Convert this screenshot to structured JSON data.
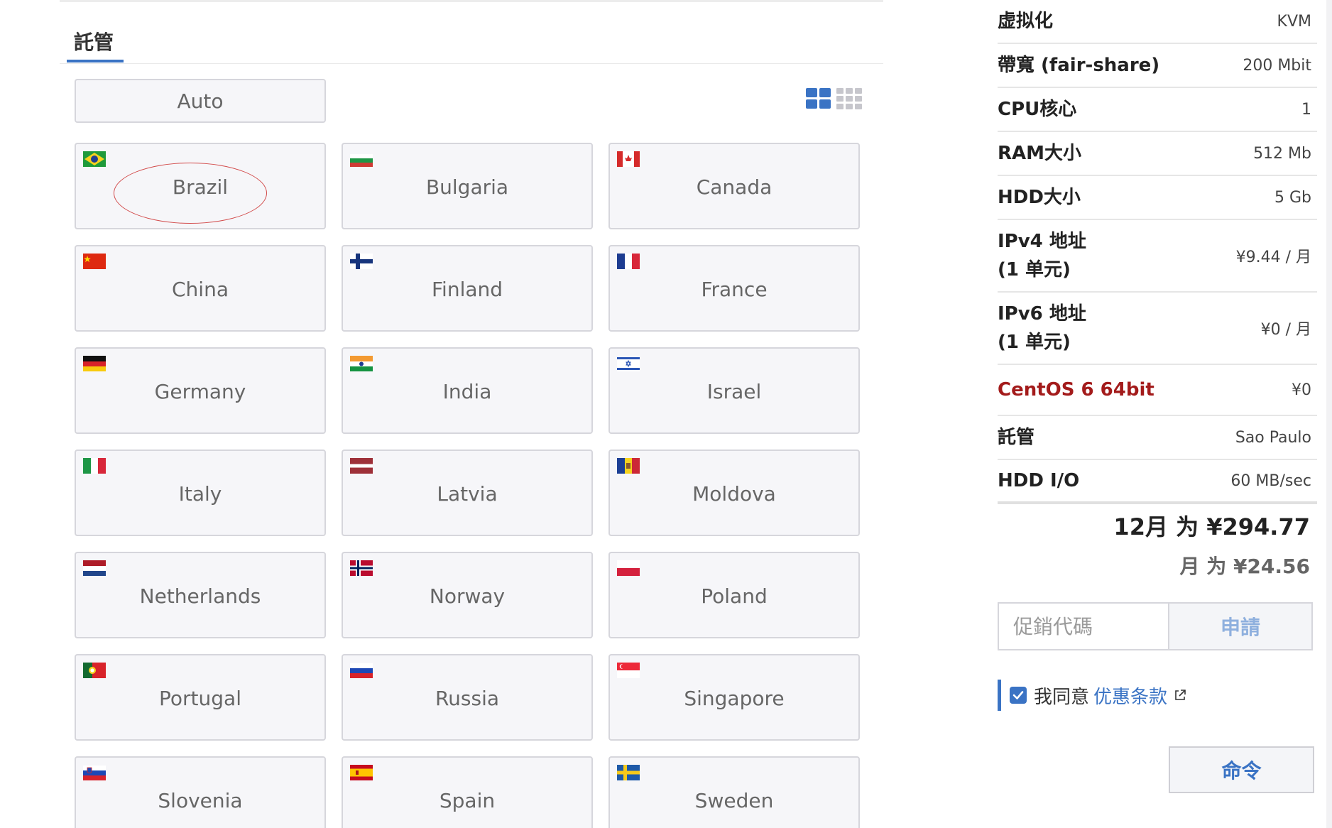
{
  "tabs": {
    "hosting_label": "託管"
  },
  "location_selector": {
    "auto_label": "Auto",
    "view_toggle": {
      "active": "large-grid-icon",
      "inactive": "small-grid-icon"
    },
    "countries": [
      {
        "name": "Brazil",
        "flag": "flag-brazil-icon",
        "highlighted": true
      },
      {
        "name": "Bulgaria",
        "flag": "flag-bulgaria-icon"
      },
      {
        "name": "Canada",
        "flag": "flag-canada-icon"
      },
      {
        "name": "China",
        "flag": "flag-china-icon"
      },
      {
        "name": "Finland",
        "flag": "flag-finland-icon"
      },
      {
        "name": "France",
        "flag": "flag-france-icon"
      },
      {
        "name": "Germany",
        "flag": "flag-germany-icon"
      },
      {
        "name": "India",
        "flag": "flag-india-icon"
      },
      {
        "name": "Israel",
        "flag": "flag-israel-icon"
      },
      {
        "name": "Italy",
        "flag": "flag-italy-icon"
      },
      {
        "name": "Latvia",
        "flag": "flag-latvia-icon"
      },
      {
        "name": "Moldova",
        "flag": "flag-moldova-icon"
      },
      {
        "name": "Netherlands",
        "flag": "flag-netherlands-icon"
      },
      {
        "name": "Norway",
        "flag": "flag-norway-icon"
      },
      {
        "name": "Poland",
        "flag": "flag-poland-icon"
      },
      {
        "name": "Portugal",
        "flag": "flag-portugal-icon"
      },
      {
        "name": "Russia",
        "flag": "flag-russia-icon"
      },
      {
        "name": "Singapore",
        "flag": "flag-singapore-icon"
      },
      {
        "name": "Slovenia",
        "flag": "flag-slovenia-icon"
      },
      {
        "name": "Spain",
        "flag": "flag-spain-icon"
      },
      {
        "name": "Sweden",
        "flag": "flag-sweden-icon"
      }
    ]
  },
  "summary": {
    "specs": [
      {
        "label": "虚拟化",
        "value": "KVM"
      },
      {
        "label": "帶寬 (fair-share)",
        "value": "200 Mbit"
      },
      {
        "label": "CPU核心",
        "value": "1"
      },
      {
        "label": "RAM大小",
        "value": "512 Mb"
      },
      {
        "label": "HDD大小",
        "value": "5 Gb"
      },
      {
        "label_line1": "IPv4 地址",
        "label_line2": "(1 单元)",
        "value": "¥9.44 / 月"
      },
      {
        "label_line1": "IPv6 地址",
        "label_line2": "(1 单元)",
        "value": "¥0 / 月"
      },
      {
        "label": "CentOS 6 64bit",
        "value": "¥0"
      },
      {
        "label": "託管",
        "value": "Sao Paulo"
      },
      {
        "label": "HDD I/O",
        "value": "60 MB/sec"
      }
    ],
    "price_12_months": "12月 为 ¥294.77",
    "price_monthly": "月 为 ¥24.56",
    "promo_placeholder": "促銷代碼",
    "apply_label": "申請",
    "agree_text": "我同意",
    "terms_link": "优惠条款",
    "agree_checked": true,
    "order_label": "命令"
  },
  "colors": {
    "accent": "#3a73c4",
    "os_red": "#a31b1b",
    "highlight_red": "#d24a4a"
  }
}
